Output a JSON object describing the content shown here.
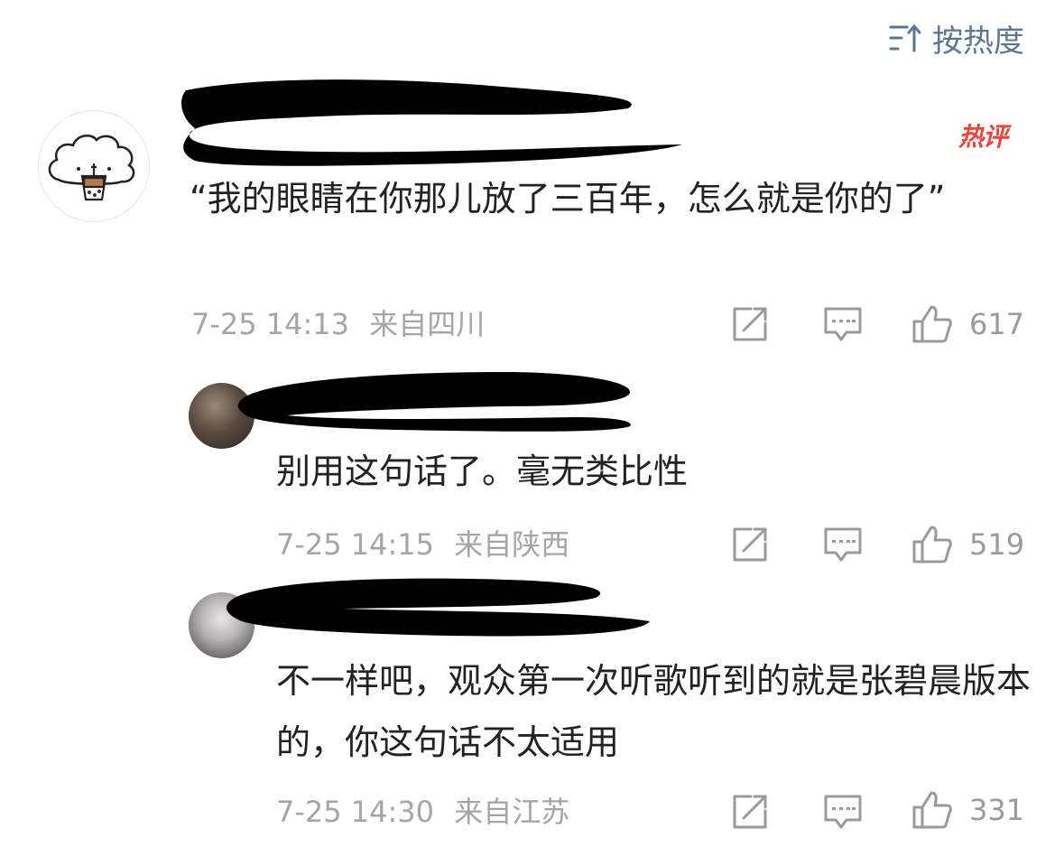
{
  "sort": {
    "label": "按热度",
    "icon": "sort-lines-icon"
  },
  "colors": {
    "link": "#5c7694",
    "hot": "#e8453c",
    "meta": "#a5a5a5",
    "redaction": "#000000"
  },
  "comments": [
    {
      "badge": "热评",
      "text": "“我的眼睛在你那儿放了三百年，怎么就是你的了”",
      "time": "7-25 14:13",
      "location": "来自四川",
      "likes": "617"
    },
    {
      "text": "别用这句话了。毫无类比性",
      "time": "7-25 14:15",
      "location": "来自陕西",
      "likes": "519"
    },
    {
      "text": "不一样吧，观众第一次听歌听到的就是张碧晨版本的，你这句话不太适用",
      "time": "7-25 14:30",
      "location": "来自江苏",
      "likes": "331"
    }
  ],
  "icons": {
    "share": "share-icon",
    "comment": "comment-icon",
    "like": "thumb-up-icon"
  }
}
